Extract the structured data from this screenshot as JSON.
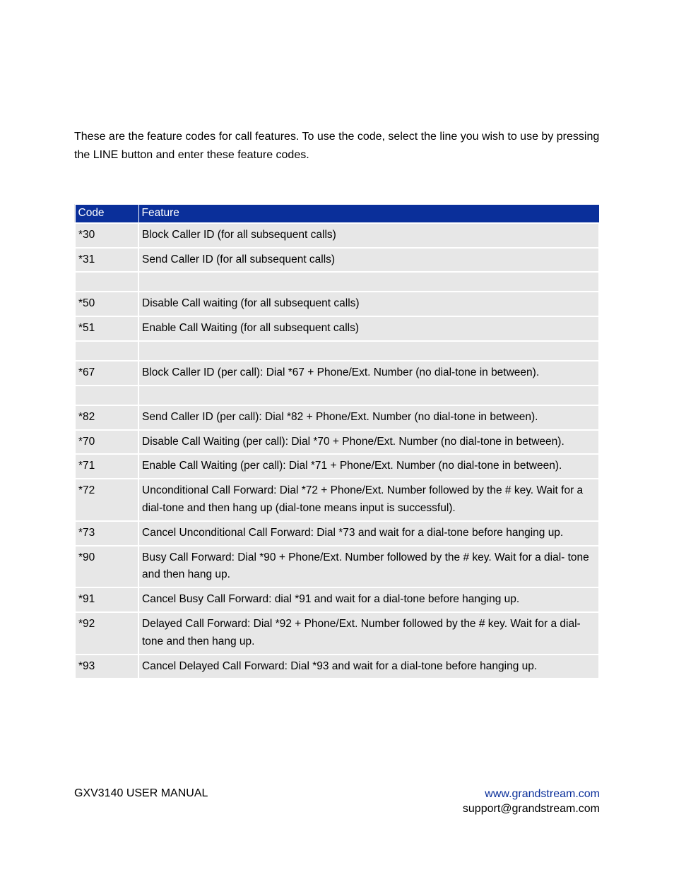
{
  "intro": "These are the feature codes for call features. To use the code, select the line you wish to use by pressing the LINE button and enter these feature codes.",
  "table": {
    "header_code": "Code",
    "header_feature": "Feature",
    "rows": [
      {
        "code": "*30",
        "feature": "Block Caller ID (for all subsequent calls)",
        "spacer_after": false,
        "justify": false
      },
      {
        "code": "*31",
        "feature": "Send Caller ID (for all subsequent calls)",
        "spacer_after": true,
        "justify": false
      },
      {
        "code": "*50",
        "feature": "Disable Call waiting (for all subsequent calls)",
        "spacer_after": false,
        "justify": false
      },
      {
        "code": "*51",
        "feature": "Enable Call Waiting (for all subsequent calls)",
        "spacer_after": true,
        "justify": false
      },
      {
        "code": "*67",
        "feature": "Block Caller ID (per call): Dial *67 + Phone/Ext. Number (no dial-tone in between).",
        "spacer_after": true,
        "justify": false
      },
      {
        "code": "*82",
        "feature": "Send Caller ID (per call): Dial *82 + Phone/Ext. Number (no dial-tone in between).",
        "spacer_after": false,
        "justify": false
      },
      {
        "code": "*70",
        "feature": "Disable Call Waiting (per call): Dial *70 + Phone/Ext. Number (no dial-tone in between).",
        "spacer_after": false,
        "justify": false
      },
      {
        "code": "*71",
        "feature": "Enable Call Waiting (per call): Dial *71 + Phone/Ext. Number (no dial-tone in between).",
        "spacer_after": false,
        "justify": false
      },
      {
        "code": "*72",
        "feature": "Unconditional Call Forward: Dial *72 + Phone/Ext. Number followed by the # key. Wait for a dial-tone and then hang up (dial-tone means input is successful).",
        "spacer_after": false,
        "justify": true
      },
      {
        "code": "*73",
        "feature": "Cancel Unconditional Call Forward: Dial *73 and wait for a dial-tone before hanging up.",
        "spacer_after": false,
        "justify": false
      },
      {
        "code": "*90",
        "feature": "Busy Call Forward: Dial *90 + Phone/Ext. Number followed by the # key. Wait for a dial- tone and then hang up.",
        "spacer_after": false,
        "justify": true
      },
      {
        "code": "*91",
        "feature": "Cancel Busy Call Forward: dial *91 and wait for a dial-tone before hanging up.",
        "spacer_after": false,
        "justify": false
      },
      {
        "code": "*92",
        "feature": "Delayed Call Forward: Dial *92 + Phone/Ext. Number followed by the # key. Wait for a dial-tone and then hang up.",
        "spacer_after": false,
        "justify": true
      },
      {
        "code": "*93",
        "feature": "Cancel Delayed Call Forward: Dial *93 and wait for a dial-tone before hanging up.",
        "spacer_after": false,
        "justify": false
      }
    ]
  },
  "footer": {
    "left": "GXV3140 USER MANUAL",
    "url": "www.grandstream.com",
    "email": "support@grandstream.com"
  }
}
